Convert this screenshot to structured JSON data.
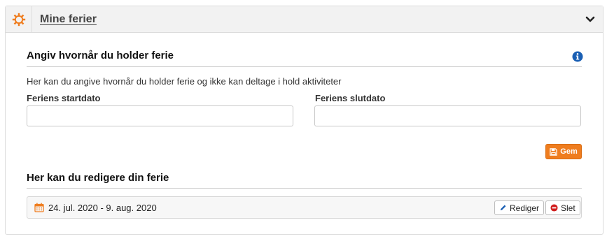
{
  "header": {
    "title": "Mine ferier",
    "icon": "gear-icon",
    "collapse_icon": "chevron-down-icon",
    "accent_color": "#ef7d1f"
  },
  "form": {
    "section_title": "Angiv hvornår du holder ferie",
    "description": "Her kan du angive hvornår du holder ferie og ikke kan deltage i hold aktiviteter",
    "start_label": "Feriens startdato",
    "start_value": "",
    "end_label": "Feriens slutdato",
    "end_value": "",
    "save_label": "Gem",
    "info_icon": "info-icon"
  },
  "edit": {
    "section_title": "Her kan du redigere din ferie",
    "vacations": [
      {
        "dates": "24. jul. 2020 - 9. aug. 2020",
        "edit_label": "Rediger",
        "delete_label": "Slet"
      }
    ]
  }
}
